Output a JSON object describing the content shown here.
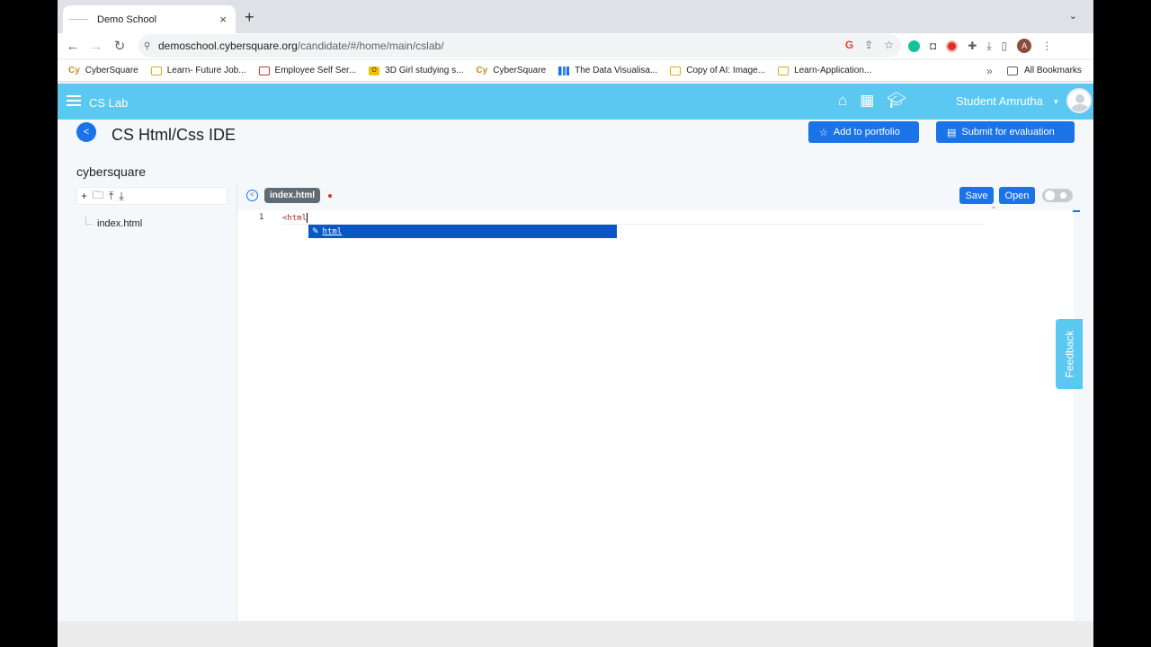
{
  "browser": {
    "tab_title": "Demo School",
    "tab_close": "×",
    "new_tab": "+",
    "url_host": "demoschool.cybersquare.org",
    "url_path": "/candidate/#/home/main/cslab/",
    "profile_initial": "A",
    "bookmarks": [
      {
        "label": "CyberSquare",
        "icon": "cybersquare-icon"
      },
      {
        "label": "Learn- Future Job...",
        "icon": "folder-icon"
      },
      {
        "label": "Employee Self Ser...",
        "icon": "portal-icon"
      },
      {
        "label": "3D Girl studying s...",
        "icon": "image-site-icon"
      },
      {
        "label": "CyberSquare",
        "icon": "cybersquare-icon"
      },
      {
        "label": "The Data Visualisa...",
        "icon": "chart-icon"
      },
      {
        "label": "Copy of AI: Image...",
        "icon": "folder-icon"
      },
      {
        "label": "Learn-Application...",
        "icon": "folder-icon"
      }
    ],
    "bookmarks_more": "»",
    "all_bookmarks": "All Bookmarks"
  },
  "app": {
    "title": "CS Lab",
    "user_name": "Student Amrutha",
    "page_title": "CS Html/Css IDE",
    "add_portfolio_label": "Add to portfolio",
    "submit_label": "Submit for evaluation",
    "project_name": "cybersquare",
    "tree_file": "index.html",
    "feedback_label": "Feedback"
  },
  "editor": {
    "open_tab": "index.html",
    "save_label": "Save",
    "open_label": "Open",
    "line_number": "1",
    "code_line": "<html",
    "autocomplete_item": "html"
  },
  "colors": {
    "accent_blue": "#1a73e8",
    "app_bar": "#5bc8f1",
    "autocomplete_bg": "#0b56c5"
  }
}
